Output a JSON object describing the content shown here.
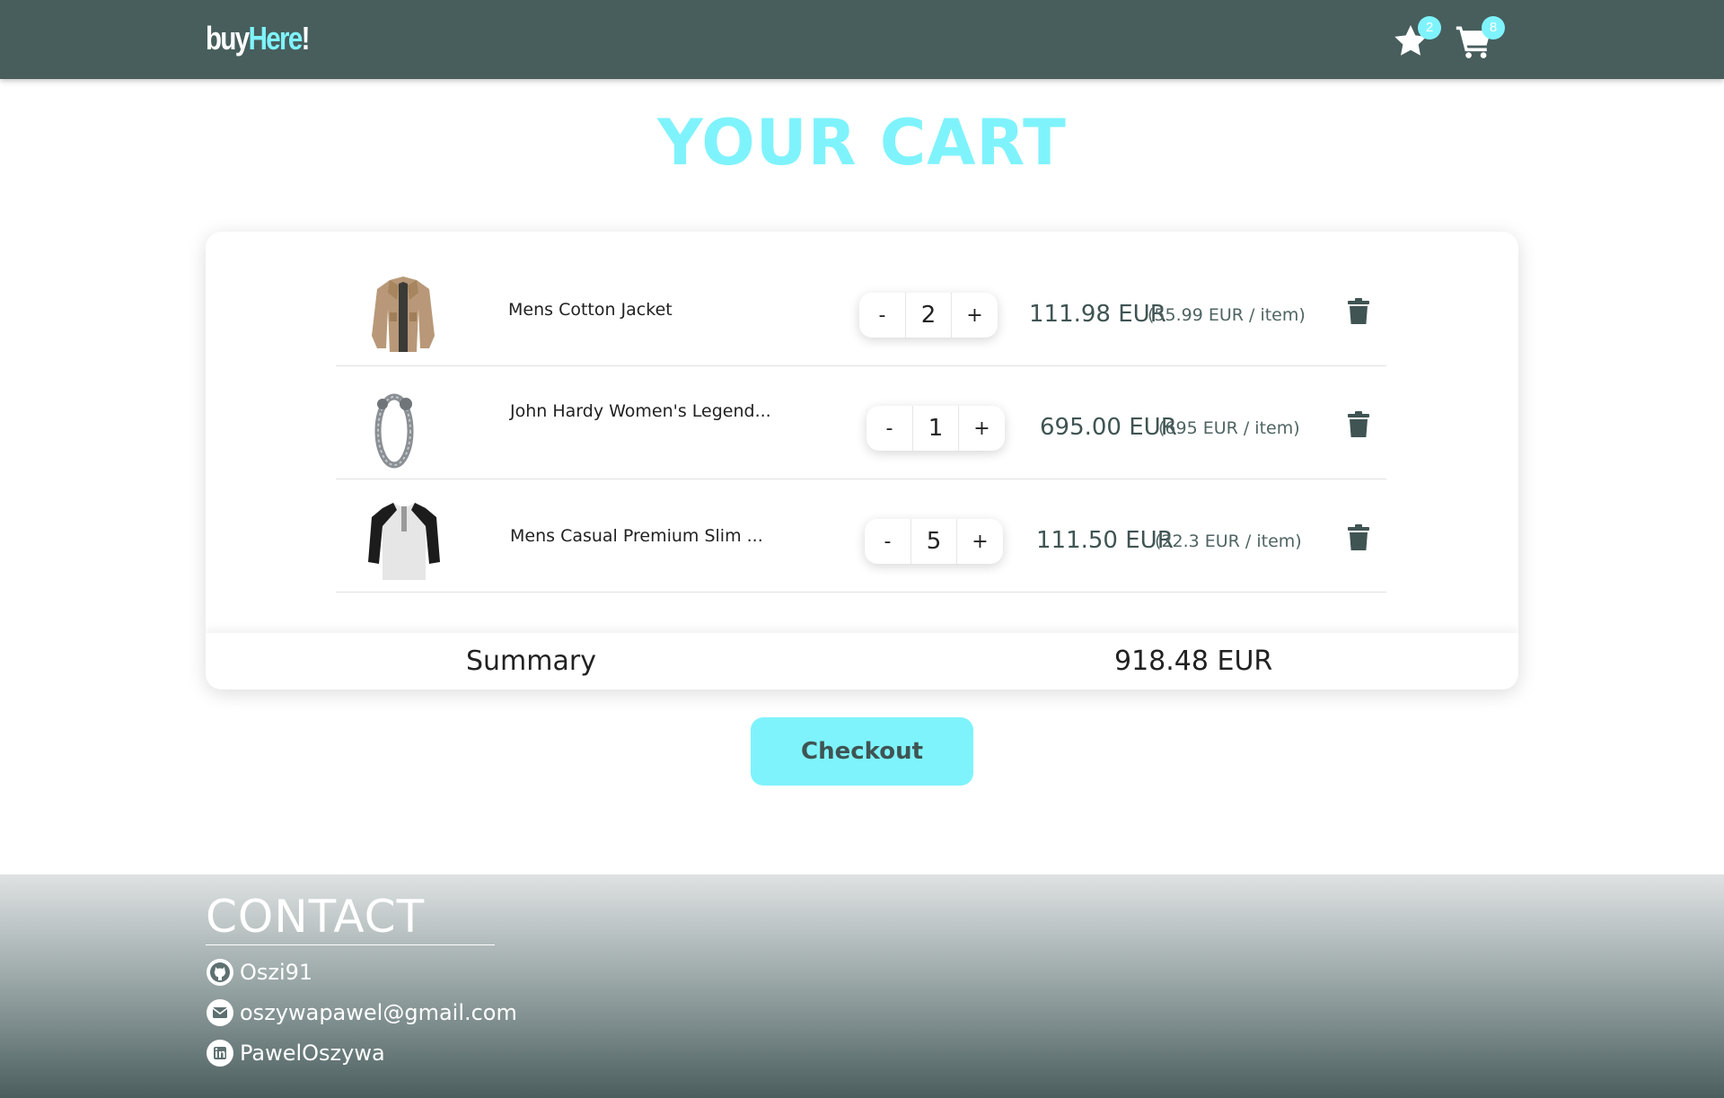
{
  "header": {
    "logo": {
      "part1": "buy",
      "part2": "Here",
      "part3": "!"
    },
    "favorites": {
      "icon": "star-icon",
      "count": "2"
    },
    "cart": {
      "icon": "cart-icon",
      "count": "8"
    }
  },
  "page": {
    "title": "YOUR CART"
  },
  "cart": {
    "items": [
      {
        "name": "Mens Cotton Jacket",
        "quantity": "2",
        "decrement": "-",
        "increment": "+",
        "line_total": "111.98 EUR",
        "unit_price": "(55.99 EUR / item)",
        "image": "jacket-image"
      },
      {
        "name": "John Hardy Women's Legend...",
        "quantity": "1",
        "decrement": "-",
        "increment": "+",
        "line_total": "695.00 EUR",
        "unit_price": "(695 EUR / item)",
        "image": "bracelet-image"
      },
      {
        "name": "Mens Casual Premium Slim ...",
        "quantity": "5",
        "decrement": "-",
        "increment": "+",
        "line_total": "111.50 EUR",
        "unit_price": "(22.3 EUR / item)",
        "image": "tshirt-image"
      }
    ],
    "summary_label": "Summary",
    "summary_total": "918.48 EUR",
    "checkout_label": "Checkout"
  },
  "footer": {
    "title": "CONTACT",
    "items": [
      {
        "icon": "github-icon",
        "text": "Oszi91"
      },
      {
        "icon": "envelope-icon",
        "text": "oszywapawel@gmail.com"
      },
      {
        "icon": "linkedin-icon",
        "text": "PawelOszywa"
      }
    ]
  },
  "colors": {
    "header_bg": "#475e5d",
    "accent": "#7ff3fc",
    "text_dark": "#3f5453"
  }
}
